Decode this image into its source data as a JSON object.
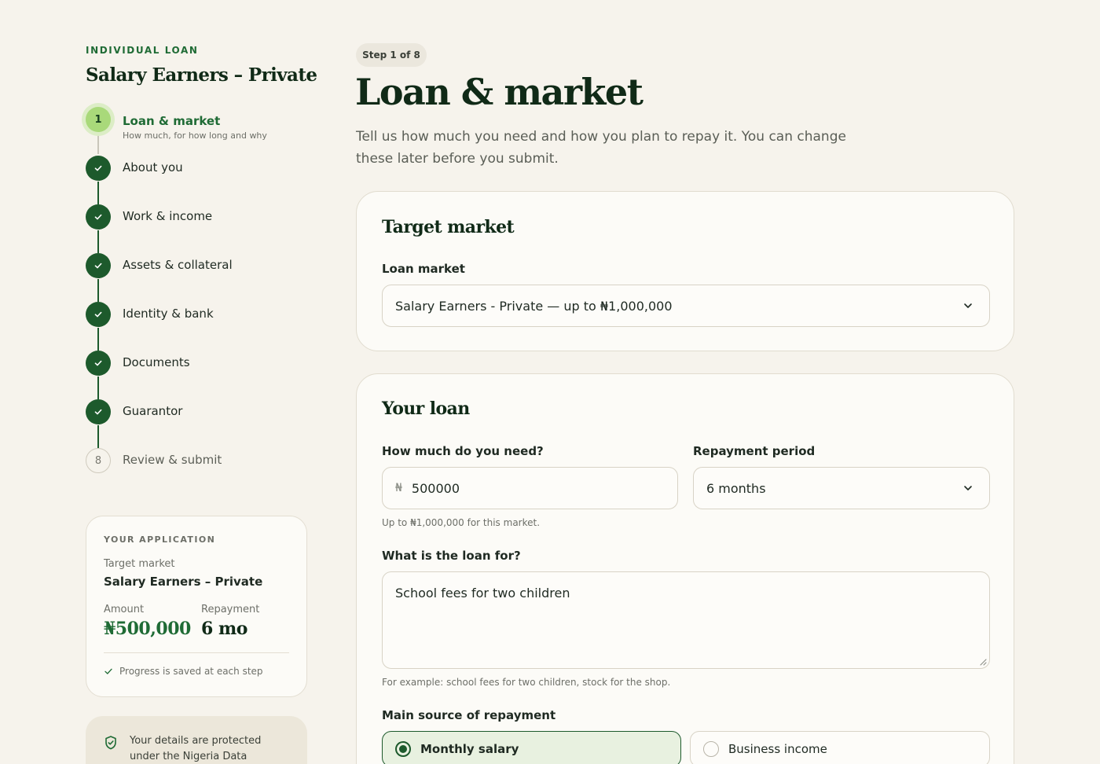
{
  "sidebar": {
    "eyebrow": "INDIVIDUAL LOAN",
    "title": "Salary Earners – Private",
    "steps": [
      {
        "number": "1",
        "label": "Loan & market",
        "sub": "How much, for how long and why",
        "state": "current"
      },
      {
        "label": "About you",
        "state": "done"
      },
      {
        "label": "Work & income",
        "state": "done"
      },
      {
        "label": "Assets & collateral",
        "state": "done"
      },
      {
        "label": "Identity & bank",
        "state": "done"
      },
      {
        "label": "Documents",
        "state": "done"
      },
      {
        "label": "Guarantor",
        "state": "done"
      },
      {
        "number": "8",
        "label": "Review & submit",
        "state": "todo"
      }
    ],
    "application": {
      "caption": "YOUR APPLICATION",
      "target_label": "Target market",
      "target_value": "Salary Earners – Private",
      "amount_label": "Amount",
      "amount_value": "₦500,000",
      "repayment_label": "Repayment",
      "repayment_value": "6 mo",
      "saved_note": "Progress is saved at each step"
    },
    "protect": {
      "text": "Your details are protected under the Nigeria Data"
    }
  },
  "main": {
    "step_pill": "Step 1 of 8",
    "title": "Loan & market",
    "lede": "Tell us how much you need and how you plan to repay it. You can change these later before you submit.",
    "target_card": {
      "title": "Target market",
      "market_label": "Loan market",
      "market_value": "Salary Earners - Private — up to ₦1,000,000"
    },
    "loan_card": {
      "title": "Your loan",
      "amount_label": "How much do you need?",
      "currency_symbol": "₦",
      "amount_value": "500000",
      "amount_hint": "Up to ₦1,000,000 for this market.",
      "period_label": "Repayment period",
      "period_value": "6 months",
      "purpose_label": "What is the loan for?",
      "purpose_value": "School fees for two children",
      "purpose_hint": "For example: school fees for two children, stock for the shop.",
      "source_label": "Main source of repayment",
      "source_options": [
        {
          "label": "Monthly salary",
          "selected": true
        },
        {
          "label": "Business income",
          "selected": false
        }
      ]
    }
  },
  "colors": {
    "accent": "#1d5a2c",
    "accent_text": "#1f6b35",
    "current_step": "#a9d97a",
    "background": "#f6f3ec"
  }
}
